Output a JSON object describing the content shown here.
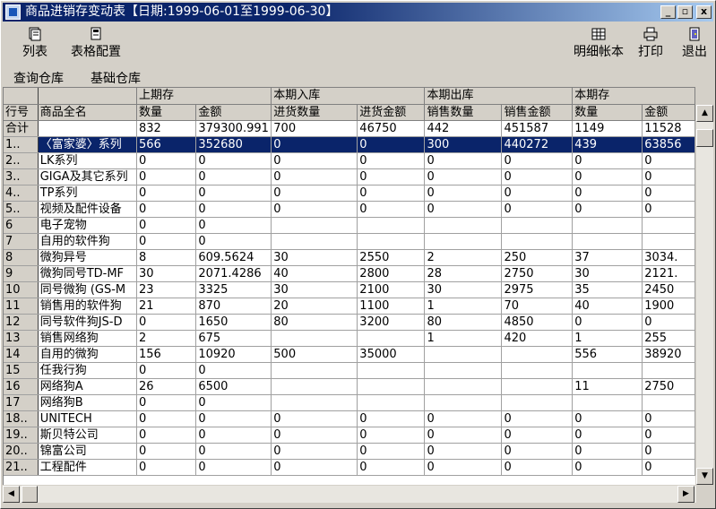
{
  "window": {
    "title": "商品进销存变动表【日期:1999-06-01至1999-06-30】",
    "min_glyph": "_",
    "max_glyph": "▫",
    "close_glyph": "x"
  },
  "toolbar": {
    "list": "列表",
    "table_config": "表格配置",
    "detail_ledger": "明细帐本",
    "print": "打印",
    "exit": "退出"
  },
  "menu": {
    "query_warehouse": "查询仓库",
    "base_warehouse": "基础仓库"
  },
  "grid": {
    "groups": [
      "上期存",
      "本期入库",
      "本期出库",
      "本期存"
    ],
    "headers": [
      "行号",
      "商品全名",
      "数量",
      "金额",
      "进货数量",
      "进货金额",
      "销售数量",
      "销售金额",
      "数量",
      "金额"
    ],
    "total": [
      "合计",
      "",
      "832",
      "379300.991",
      "700",
      "46750",
      "442",
      "451587",
      "1149",
      "11528"
    ],
    "rows": [
      [
        "1..",
        "〈富家婆〉系列",
        "566",
        "352680",
        "0",
        "0",
        "300",
        "440272",
        "439",
        "63856"
      ],
      [
        "2..",
        "LK系列",
        "0",
        "0",
        "0",
        "0",
        "0",
        "0",
        "0",
        "0"
      ],
      [
        "3..",
        "GIGA及其它系列",
        "0",
        "0",
        "0",
        "0",
        "0",
        "0",
        "0",
        "0"
      ],
      [
        "4..",
        "TP系列",
        "0",
        "0",
        "0",
        "0",
        "0",
        "0",
        "0",
        "0"
      ],
      [
        "5..",
        "视频及配件设备",
        "0",
        "0",
        "0",
        "0",
        "0",
        "0",
        "0",
        "0"
      ],
      [
        "6",
        "电子宠物",
        "0",
        "0",
        "",
        "",
        "",
        "",
        "",
        ""
      ],
      [
        "7",
        "自用的软件狗",
        "0",
        "0",
        "",
        "",
        "",
        "",
        "",
        ""
      ],
      [
        "8",
        "微狗异号",
        "8",
        "609.5624",
        "30",
        "2550",
        "2",
        "250",
        "37",
        "3034."
      ],
      [
        "9",
        "微狗同号TD-MF",
        "30",
        "2071.4286",
        "40",
        "2800",
        "28",
        "2750",
        "30",
        "2121."
      ],
      [
        "10",
        "同号微狗 (GS-M",
        "23",
        "3325",
        "30",
        "2100",
        "30",
        "2975",
        "35",
        "2450"
      ],
      [
        "11",
        "销售用的软件狗",
        "21",
        "870",
        "20",
        "1100",
        "1",
        "70",
        "40",
        "1900"
      ],
      [
        "12",
        "同号软件狗JS-D",
        "0",
        "1650",
        "80",
        "3200",
        "80",
        "4850",
        "0",
        "0"
      ],
      [
        "13",
        "销售网络狗",
        "2",
        "675",
        "",
        "",
        "1",
        "420",
        "1",
        "255"
      ],
      [
        "14",
        "自用的微狗",
        "156",
        "10920",
        "500",
        "35000",
        "",
        "",
        "556",
        "38920"
      ],
      [
        "15",
        "任我行狗",
        "0",
        "0",
        "",
        "",
        "",
        "",
        "",
        ""
      ],
      [
        "16",
        "网络狗A",
        "26",
        "6500",
        "",
        "",
        "",
        "",
        "11",
        "2750"
      ],
      [
        "17",
        "网络狗B",
        "0",
        "0",
        "",
        "",
        "",
        "",
        "",
        ""
      ],
      [
        "18..",
        "UNITECH",
        "0",
        "0",
        "0",
        "0",
        "0",
        "0",
        "0",
        "0"
      ],
      [
        "19..",
        "斯贝特公司",
        "0",
        "0",
        "0",
        "0",
        "0",
        "0",
        "0",
        "0"
      ],
      [
        "20..",
        "锦富公司",
        "0",
        "0",
        "0",
        "0",
        "0",
        "0",
        "0",
        "0"
      ],
      [
        "21..",
        "工程配件",
        "0",
        "0",
        "0",
        "0",
        "0",
        "0",
        "0",
        "0"
      ]
    ]
  }
}
